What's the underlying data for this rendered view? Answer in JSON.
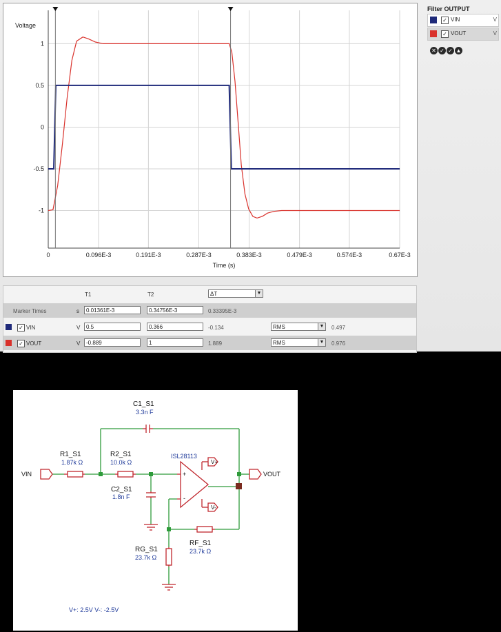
{
  "filter": {
    "title": "Filter OUTPUT",
    "items": [
      {
        "name": "VIN",
        "unit": "V",
        "color": "#1f2a7a",
        "checked": true
      },
      {
        "name": "VOUT",
        "unit": "V",
        "color": "#d9312b",
        "checked": true
      }
    ],
    "icons": [
      "close-icon",
      "check-icon",
      "check-icon",
      "up-icon"
    ]
  },
  "chart_data": {
    "type": "line",
    "ylabel": "Voltage",
    "xlabel": "Time (s)",
    "ylim": [
      -1.45,
      1.4
    ],
    "xlim": [
      0,
      0.00067
    ],
    "yticks": [
      "1",
      "0.5",
      "0",
      "-0.5",
      "-1"
    ],
    "xticks": [
      "0",
      "0.096E-3",
      "0.191E-3",
      "0.287E-3",
      "0.383E-3",
      "0.479E-3",
      "0.574E-3",
      "0.67E-3"
    ],
    "grid": true,
    "markers_x": [
      1.361e-05,
      0.00034756
    ],
    "series": [
      {
        "name": "VIN",
        "color": "#1f2a7a",
        "x": [
          0,
          1.05e-05,
          1.45e-05,
          0.000345,
          0.000349,
          0.00067
        ],
        "y": [
          -0.5,
          -0.5,
          0.5,
          0.5,
          -0.5,
          -0.5
        ]
      },
      {
        "name": "VOUT",
        "color": "#d9312b",
        "x": [
          0,
          9e-06,
          1.8e-05,
          2.7e-05,
          3.6e-05,
          4.5e-05,
          5.4e-05,
          6.6e-05,
          7.6e-05,
          9e-05,
          0.000105,
          0.00012,
          0.000345,
          0.00035,
          0.000356,
          0.000362,
          0.000368,
          0.000375,
          0.000382,
          0.00039,
          0.000398,
          0.000408,
          0.000418,
          0.00043,
          0.000445,
          0.00046,
          0.00067
        ],
        "y": [
          -1.0,
          -0.99,
          -0.7,
          -0.2,
          0.35,
          0.8,
          1.03,
          1.08,
          1.06,
          1.02,
          1.0,
          1.0,
          1.0,
          0.9,
          0.55,
          0.05,
          -0.45,
          -0.8,
          -0.98,
          -1.07,
          -1.09,
          -1.07,
          -1.03,
          -1.01,
          -1.0,
          -1.0,
          -1.0
        ]
      }
    ]
  },
  "markers": {
    "t1_header": "T1",
    "t2_header": "T2",
    "delta_select": "ΔT",
    "times_label": "Marker Times",
    "times_unit": "s",
    "t1_time": "0.01361E-3",
    "t2_time": "0.34756E-3",
    "delta_time": "0.33395E-3",
    "rows": [
      {
        "name": "VIN",
        "unit": "V",
        "t1": "0.5",
        "t2": "0.366",
        "delta": "-0.134",
        "func": "RMS",
        "func_value": "0.497"
      },
      {
        "name": "VOUT",
        "unit": "V",
        "t1": "-0.889",
        "t2": "1",
        "delta": "1.889",
        "func": "RMS",
        "func_value": "0.976"
      }
    ]
  },
  "schematic": {
    "c1": {
      "name": "C1_S1",
      "value": "3.3n F"
    },
    "r1": {
      "name": "R1_S1",
      "value": "1.87k Ω"
    },
    "r2": {
      "name": "R2_S1",
      "value": "10.0k Ω"
    },
    "c2": {
      "name": "C2_S1",
      "value": "1.8n F"
    },
    "rg": {
      "name": "RG_S1",
      "value": "23.7k Ω"
    },
    "rf": {
      "name": "RF_S1",
      "value": "23.7k Ω"
    },
    "opamp": "ISL28113",
    "vin": "VIN",
    "vout": "VOUT",
    "vplus": "V+",
    "vminus": "V-",
    "plus_sign": "+",
    "minus_sign": "-",
    "supplies": "V+: 2.5V  V-: -2.5V"
  }
}
